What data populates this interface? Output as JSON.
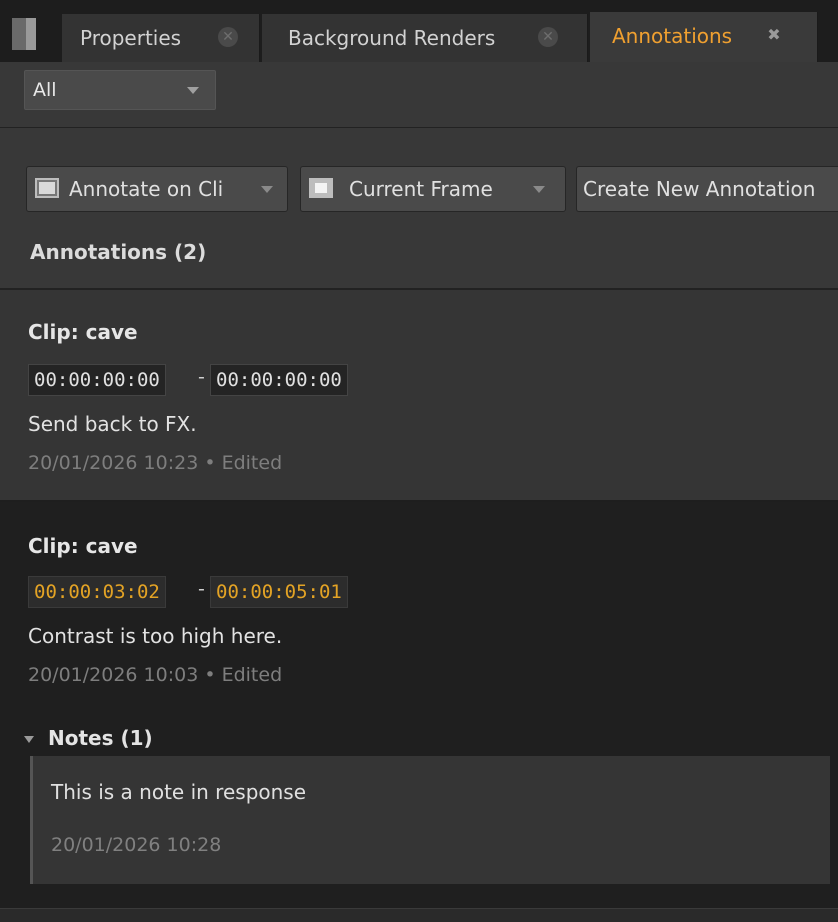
{
  "tabs": [
    {
      "label": "Properties",
      "active": false
    },
    {
      "label": "Background Renders",
      "active": false
    },
    {
      "label": "Annotations",
      "active": true
    }
  ],
  "filter": {
    "selected": "All"
  },
  "toolbar": {
    "annotate_label": "Annotate on Cli",
    "frame_label": "Current Frame",
    "create_label": "Create New Annotation"
  },
  "annotations_header": "Annotations (2)",
  "annotations": [
    {
      "clip": "Clip: cave",
      "tc_in": "00:00:00:00",
      "tc_out": "00:00:00:00",
      "separator": "-",
      "text": "Send back to FX.",
      "meta": "20/01/2026 10:23 • Edited"
    },
    {
      "clip": "Clip: cave",
      "tc_in": "00:00:03:02",
      "tc_out": "00:00:05:01",
      "separator": "-",
      "text": "Contrast is too high here.",
      "meta": "20/01/2026 10:03 • Edited",
      "notes_header": "Notes (1)",
      "notes": [
        {
          "text": "This is a note in response",
          "time": "20/01/2026 10:28"
        }
      ]
    }
  ],
  "colors": {
    "accent": "#f0a030",
    "timecode_highlight": "#e3a325",
    "panel_bg": "#2e2e2e"
  },
  "icons": [
    "close-icon",
    "dropdown-caret-icon",
    "film-clip-icon",
    "frame-icon",
    "expand-triangle-icon"
  ]
}
